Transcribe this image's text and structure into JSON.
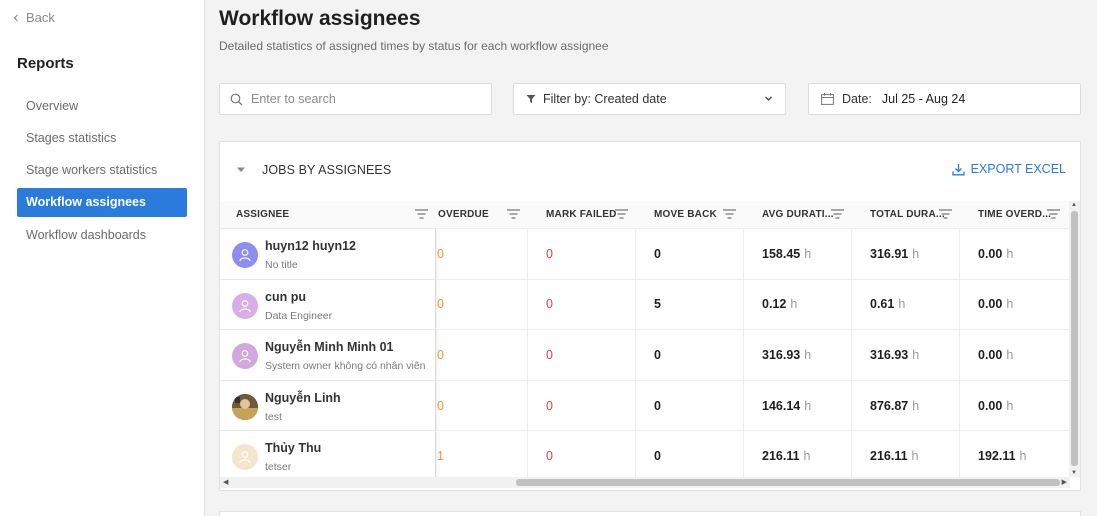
{
  "sidebar": {
    "back_label": "Back",
    "section_title": "Reports",
    "items": [
      {
        "label": "Overview"
      },
      {
        "label": "Stages statistics"
      },
      {
        "label": "Stage workers statistics"
      },
      {
        "label": "Workflow assignees"
      },
      {
        "label": "Workflow dashboards"
      }
    ]
  },
  "header": {
    "title": "Workflow assignees",
    "subtitle": "Detailed statistics of assigned times by status for each workflow assignee"
  },
  "search": {
    "placeholder": "Enter to search"
  },
  "filter": {
    "label": "Filter by: Created date"
  },
  "date": {
    "label": "Date:",
    "value": "Jul 25 - Aug 24"
  },
  "card": {
    "title": "JOBS BY ASSIGNEES",
    "export_label": "EXPORT EXCEL"
  },
  "columns": [
    "ASSIGNEE",
    "OVERDUE",
    "MARK FAILED",
    "MOVE BACK",
    "AVG DURATI...",
    "TOTAL DURA...",
    "TIME OVERD..."
  ],
  "unit": "h",
  "rows": [
    {
      "name": "huyn12 huyn12",
      "role": "No title",
      "overdue": "0",
      "mark_failed": "0",
      "move_back": "0",
      "avg": "158.45",
      "total": "316.91",
      "time_overdue": "0.00",
      "avatar_color": "#8e8ef0"
    },
    {
      "name": "cun pu",
      "role": "Data Engineer",
      "overdue": "0",
      "mark_failed": "0",
      "move_back": "5",
      "avg": "0.12",
      "total": "0.61",
      "time_overdue": "0.00",
      "avatar_color": "#d8aee6"
    },
    {
      "name": "Nguyễn Minh Minh 01",
      "role": "System owner không có nhân viên",
      "overdue": "0",
      "mark_failed": "0",
      "move_back": "0",
      "avg": "316.93",
      "total": "316.93",
      "time_overdue": "0.00",
      "avatar_color": "#d3a8df"
    },
    {
      "name": "Nguyễn Linh",
      "role": "test",
      "overdue": "0",
      "mark_failed": "0",
      "move_back": "0",
      "avg": "146.14",
      "total": "876.87",
      "time_overdue": "0.00",
      "avatar_color": "#8a6b3f"
    },
    {
      "name": "Thủy Thu",
      "role": "tetser",
      "overdue": "1",
      "mark_failed": "0",
      "move_back": "0",
      "avg": "216.11",
      "total": "216.11",
      "time_overdue": "192.11",
      "avatar_color": "#f3e6cf"
    }
  ]
}
